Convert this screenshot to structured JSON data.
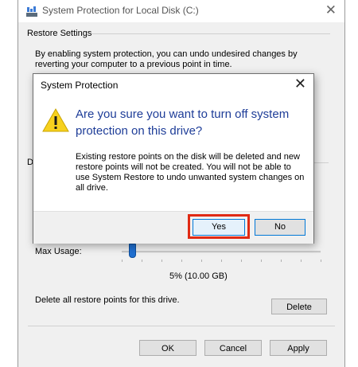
{
  "window": {
    "title": "System Protection for Local Disk (C:)",
    "restore_settings_label": "Restore Settings",
    "description": "By enabling system protection, you can undo undesired changes by reverting your computer to a previous point in time.",
    "partial_label": "D",
    "max_usage_label": "Max Usage:",
    "max_usage_value": "5% (10.00 GB)",
    "max_usage_fraction": 0.05,
    "delete_text": "Delete all restore points for this drive.",
    "delete_button": "Delete",
    "ok_button": "OK",
    "cancel_button": "Cancel",
    "apply_button": "Apply"
  },
  "dialog": {
    "title": "System Protection",
    "question": "Are you sure you want to turn off system protection on this drive?",
    "body": "Existing restore points on the disk will be deleted and new restore points will not be created. You will not be able to use System Restore to undo unwanted system changes on all drive.",
    "yes_button": "Yes",
    "no_button": "No",
    "icon": "warning-icon",
    "highlight_color": "#e02a14"
  }
}
